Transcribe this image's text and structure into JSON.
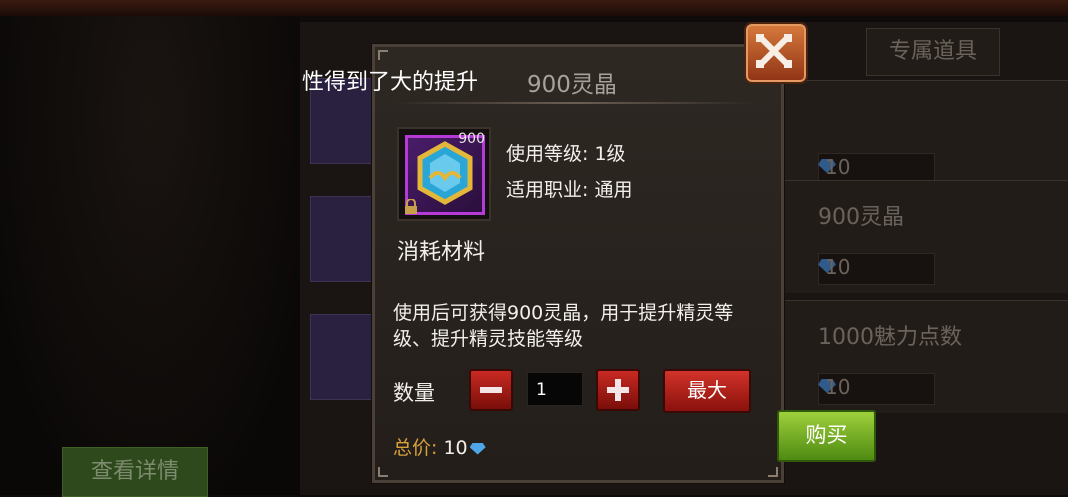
{
  "background": {
    "tabs": [
      {
        "label": "专属道具"
      }
    ],
    "list_items": [
      {
        "name": "",
        "price": "10"
      },
      {
        "name": "900灵晶",
        "price": "10"
      },
      {
        "name": "1000魅力点数",
        "price": "10"
      }
    ],
    "detail_button": "查看详情"
  },
  "overlay_text": "性得到了大的提升",
  "modal": {
    "title": "900灵晶",
    "item": {
      "count": "900",
      "category": "消耗材料"
    },
    "stats": [
      {
        "text": "使用等级: 1级"
      },
      {
        "text": "适用职业: 通用"
      }
    ],
    "description": "使用后可获得900灵晶，用于提升精灵等级、提升精灵技能等级",
    "quantity": {
      "label": "数量",
      "value": "1"
    },
    "max_button": "最大",
    "total": {
      "label": "总价: ",
      "value": "10"
    }
  },
  "buy_button": "购买",
  "colors": {
    "accent_red": "#c82a22",
    "buy_green": "#7fbf2a",
    "price_gold": "#d8a13a",
    "close_orange": "#d77b3d"
  }
}
